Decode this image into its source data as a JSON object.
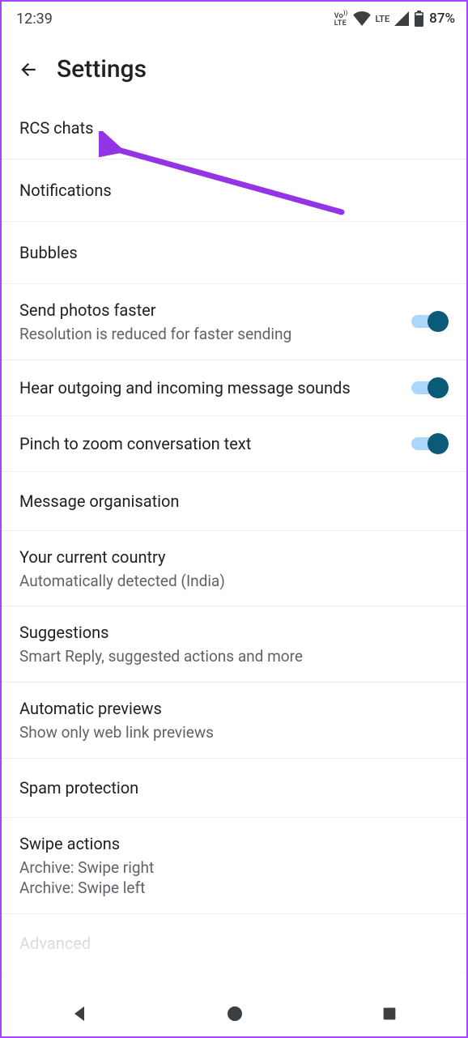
{
  "status": {
    "time": "12:39",
    "battery_pct": "87%"
  },
  "header": {
    "title": "Settings"
  },
  "rows": {
    "rcs": {
      "title": "RCS chats"
    },
    "notifications": {
      "title": "Notifications"
    },
    "bubbles": {
      "title": "Bubbles"
    },
    "send_photos": {
      "title": "Send photos faster",
      "sub": "Resolution is reduced for faster sending"
    },
    "sounds": {
      "title": "Hear outgoing and incoming message sounds"
    },
    "zoom": {
      "title": "Pinch to zoom conversation text"
    },
    "msg_org": {
      "title": "Message organisation"
    },
    "country": {
      "title": "Your current country",
      "sub": "Automatically detected (India)"
    },
    "suggestions": {
      "title": "Suggestions",
      "sub": "Smart Reply, suggested actions and more"
    },
    "previews": {
      "title": "Automatic previews",
      "sub": "Show only web link previews"
    },
    "spam": {
      "title": "Spam protection"
    },
    "swipe": {
      "title": "Swipe actions",
      "sub1": "Archive: Swipe right",
      "sub2": "Archive: Swipe left"
    },
    "advanced": {
      "title": "Advanced"
    }
  },
  "toggles": {
    "send_photos": true,
    "sounds": true,
    "zoom": true
  }
}
